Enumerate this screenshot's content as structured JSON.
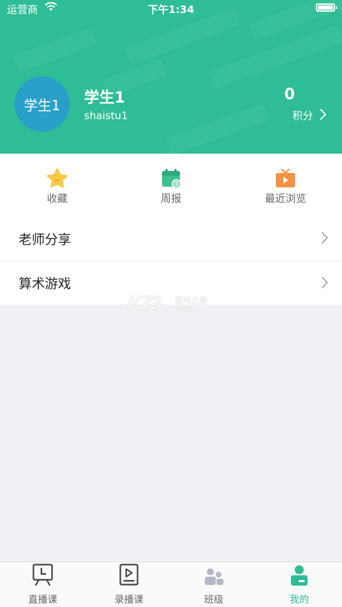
{
  "status_bar": {
    "carrier": "运营商",
    "time": "下午1:34"
  },
  "profile": {
    "avatar_text": "学生1",
    "name": "学生1",
    "username": "shaistu1",
    "points_value": "0",
    "points_label": "积分"
  },
  "shortcuts": [
    {
      "label": "收藏",
      "icon": "star-icon"
    },
    {
      "label": "周报",
      "icon": "calendar-icon",
      "badge": "7"
    },
    {
      "label": "最近浏览",
      "icon": "tv-icon"
    }
  ],
  "menu": [
    {
      "label": "老师分享"
    },
    {
      "label": "算术游戏"
    }
  ],
  "watermark": {
    "brand": "K73",
    "sub": "游戏之家",
    "domain": ".com"
  },
  "tabbar": [
    {
      "label": "直播课",
      "icon": "live-class-icon"
    },
    {
      "label": "录播课",
      "icon": "recorded-class-icon"
    },
    {
      "label": "班级",
      "icon": "class-icon"
    },
    {
      "label": "我的",
      "icon": "profile-icon",
      "active": true
    }
  ],
  "colors": {
    "brand_green": "#2ebd96",
    "avatar_blue": "#2a9fc9",
    "star_yellow": "#f7c948",
    "tv_orange": "#f29245",
    "tab_inactive": "#444444"
  }
}
